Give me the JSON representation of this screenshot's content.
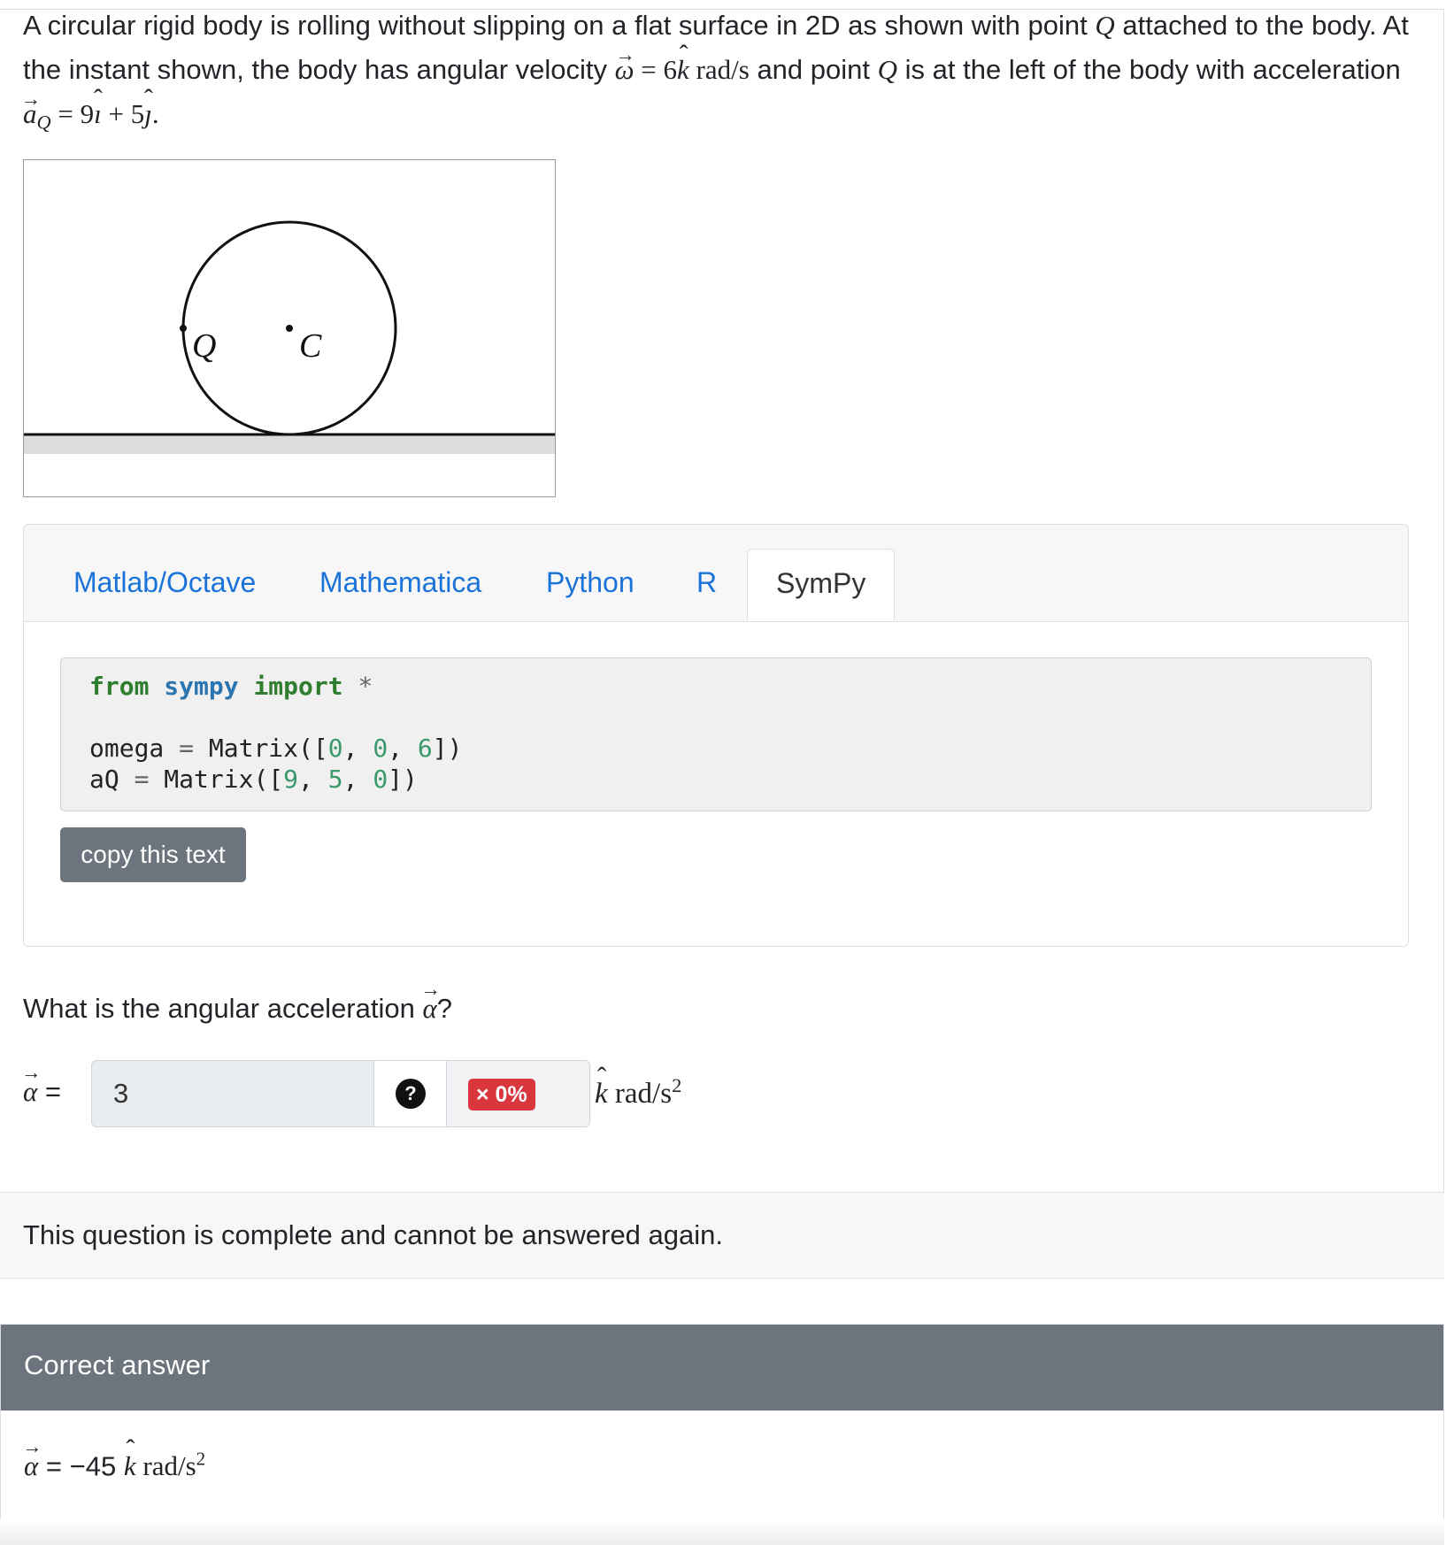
{
  "question": {
    "text_before_omega": "A circular rigid body is rolling without slipping on a flat surface in 2D as shown with point",
    "point_name": "Q",
    "text_attached": "attached to the body. At the instant shown, the body has angular velocity",
    "omega_symbol": "ω",
    "omega_value": "6",
    "k_hat": "k",
    "omega_unit": "rad/s",
    "text_and_point": "and point",
    "text_left": "is at the left of the body with acceleration",
    "accel_symbol": "a",
    "accel_sub": "Q",
    "accel_expr_i": "9",
    "i_hat": "ı",
    "accel_expr_j": "5",
    "j_hat": "ȷ"
  },
  "figure": {
    "label_point": "Q",
    "label_center": "C"
  },
  "tabs": [
    {
      "label": "Matlab/Octave"
    },
    {
      "label": "Mathematica"
    },
    {
      "label": "Python"
    },
    {
      "label": "R"
    },
    {
      "label": "SymPy"
    }
  ],
  "code": {
    "kw_from": "from",
    "module": "sympy",
    "kw_import": "import",
    "star": "*",
    "omega_name": "omega",
    "eq": "=",
    "matrix": "Matrix([",
    "omega_vals": [
      "0",
      "0",
      "6"
    ],
    "aq_name": "aQ",
    "aq_vals": [
      "9",
      "5",
      "0"
    ],
    "comma": ",",
    "close": "])"
  },
  "copy_button": "copy this text",
  "prompt": {
    "text": "What is the angular acceleration",
    "symbol": "α",
    "qmark": "?"
  },
  "answer": {
    "symbol": "α",
    "eq": "=",
    "value": "3",
    "help": "?",
    "score": "× 0%",
    "unit_k": "k",
    "unit": "rad/s",
    "unit_exp": "2"
  },
  "status": "This question is complete and cannot be answered again.",
  "correct": {
    "title": "Correct answer",
    "symbol": "α",
    "eq": "=",
    "value": "−45",
    "unit_k": "k",
    "unit": "rad/s",
    "unit_exp": "2"
  }
}
